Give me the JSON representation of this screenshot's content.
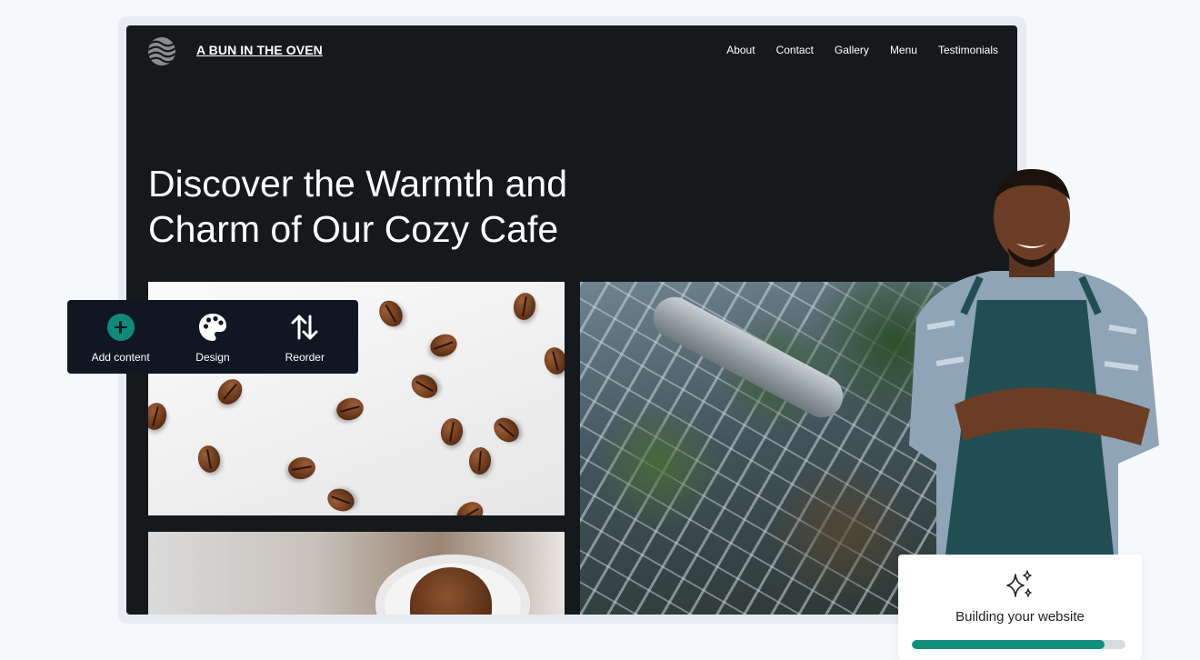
{
  "site": {
    "brand": "A BUN IN THE OVEN",
    "nav": [
      "About",
      "Contact",
      "Gallery",
      "Menu",
      "Testimonials"
    ],
    "hero_line1": "Discover the Warmth and",
    "hero_line2": "Charm of Our Cozy Cafe"
  },
  "toolbar": {
    "items": [
      {
        "label": "Add content",
        "icon": "plus-circle-icon"
      },
      {
        "label": "Design",
        "icon": "palette-icon"
      },
      {
        "label": "Reorder",
        "icon": "reorder-arrows-icon"
      }
    ]
  },
  "status": {
    "text": "Building your website",
    "icon": "sparkles-icon",
    "progress": 0.9
  },
  "colors": {
    "site_bg": "#16191c",
    "accent": "#118f7c",
    "toolbar_bg": "#101722"
  }
}
